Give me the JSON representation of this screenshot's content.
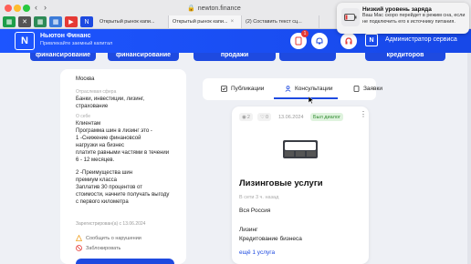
{
  "browser": {
    "address": "newton.finance",
    "tabs": [
      {
        "label": "Открытый рынок капи...",
        "active": false
      },
      {
        "label": "Открытый рынок капи...",
        "active": true
      },
      {
        "label": "(2) Составить текст сц...",
        "active": false
      }
    ]
  },
  "notification": {
    "title": "Низкий уровень заряда",
    "body": "Ваш Mac скоро перейдет в режим сна, если не подключить его к источнику питания."
  },
  "header": {
    "brand_title": "Ньютон Финанс",
    "brand_subtitle": "Привлекайте заемный капитал",
    "notifications_count": "1",
    "admin_label": "Администратор сервиса",
    "accent": "#1d55ff"
  },
  "categories": [
    "финансирование",
    "финансирование",
    "продажи",
    "",
    "кредиторов"
  ],
  "profile": {
    "city": "Москва",
    "sphere_label": "Отраслевая сфера",
    "sphere_lines": [
      "Банки, инвестиции, лизинг,",
      "страхование"
    ],
    "about_label": "О себе",
    "about_lines": [
      "Клиентам",
      "Программа шин в лизинг это -",
      "1 -Снижение финановсой",
      "нагрузки на бизнес",
      "платите равными частями в течении",
      "6 - 12 месяцев.",
      "",
      "2 -Преимущества шин",
      "премиум класса",
      "Заплатив 30 процентов от",
      "стоимости, начните получать выгоду",
      "с первого километра"
    ],
    "registered": "Зарегистрирован(а) с 13.06.2024",
    "report_label": "Сообщить о нарушении",
    "block_label": "Заблокировать"
  },
  "page_tabs": {
    "publications": "Публикации",
    "consultations": "Консультации",
    "requests": "Заявки"
  },
  "listing": {
    "views": "2",
    "likes": "0",
    "date": "13.06.2024",
    "badge": "Был диалог",
    "title": "Лизинговые услуги",
    "meta": "В сети 3 ч. назад",
    "region": "Вся Россия",
    "cat1": "Лизинг",
    "cat2": "Кредитование бизнеса",
    "more_link": "ещё 1 услуга"
  }
}
